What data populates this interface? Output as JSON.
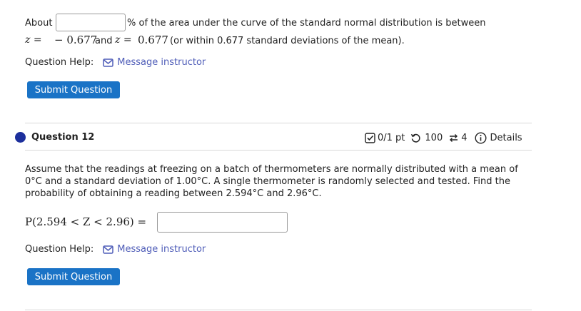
{
  "q11": {
    "about": "About",
    "pct_rest": "% of the area under the curve of the standard normal distribution is between",
    "z_eq": "z =",
    "neg_val": "− 0.677",
    "and": "and",
    "z_eq2": "z =",
    "pos_val": "0.677",
    "tail": "(or within 0.677 standard deviations of the mean).",
    "answer_value": "",
    "help_label": "Question Help:",
    "help_link": "Message instructor",
    "submit": "Submit Question"
  },
  "q12": {
    "title": "Question 12",
    "score": "0/1 pt",
    "retries": "100",
    "attempts": "4",
    "details": "Details",
    "line1": "Assume that the readings at freezing on a batch of thermometers are normally distributed with a mean of",
    "line2": "0°C and a standard deviation of 1.00°C. A single thermometer is randomly selected and tested. Find the",
    "line3": "probability of obtaining a reading between 2.594°C and 2.96°C.",
    "prob_expr": "P(2.594 < Z < 2.96) =",
    "answer_value": "",
    "help_label": "Question Help:",
    "help_link": "Message instructor",
    "submit": "Submit Question"
  },
  "colors": {
    "accent": "#1a73c6",
    "link": "#4f5db8",
    "dot": "#1c2f9c"
  },
  "icons": [
    "envelope-icon",
    "checkbox-icon",
    "retry-icon",
    "attempts-icon",
    "info-icon"
  ]
}
